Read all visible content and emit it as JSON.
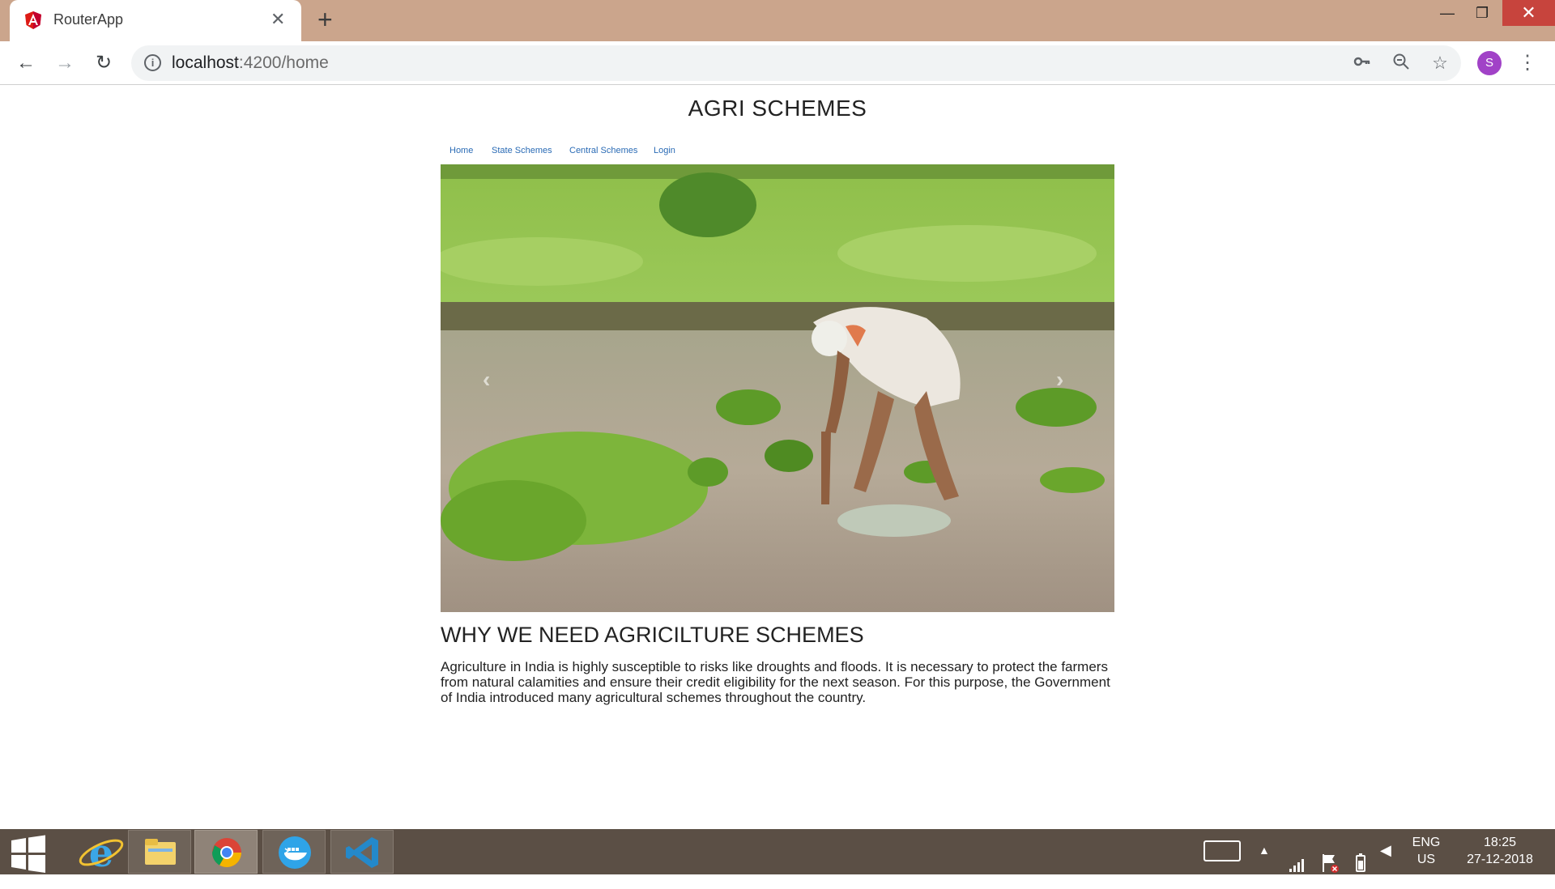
{
  "browser": {
    "tab_title": "RouterApp",
    "url_host": "localhost",
    "url_path": ":4200/home",
    "profile_initial": "S",
    "icons": {
      "back": "back-arrow-icon",
      "forward": "forward-arrow-icon",
      "reload": "reload-icon",
      "info": "info-icon",
      "key": "key-icon",
      "zoom": "zoom-icon",
      "star": "star-icon",
      "menu": "menu-icon"
    }
  },
  "page": {
    "title": "AGRI SCHEMES",
    "nav": [
      {
        "label": "Home"
      },
      {
        "label": "State Schemes"
      },
      {
        "label": "Central Schemes"
      },
      {
        "label": "Login"
      }
    ],
    "section_heading": "WHY WE NEED AGRICILTURE SCHEMES",
    "section_body": "Agriculture in India is highly susceptible to risks like droughts and floods. It is necessary to protect the farmers from natural calamities and ensure their credit eligibility for the next season. For this purpose, the Government of India introduced many agricultural schemes throughout the country.",
    "link_color": "#2a6bb5"
  },
  "taskbar": {
    "apps": [
      "start-icon",
      "internet-explorer-icon",
      "file-explorer-icon",
      "chrome-icon",
      "docker-icon",
      "vscode-icon"
    ],
    "lang_line1": "ENG",
    "lang_line2": "US",
    "time": "18:25",
    "date": "27-12-2018"
  }
}
